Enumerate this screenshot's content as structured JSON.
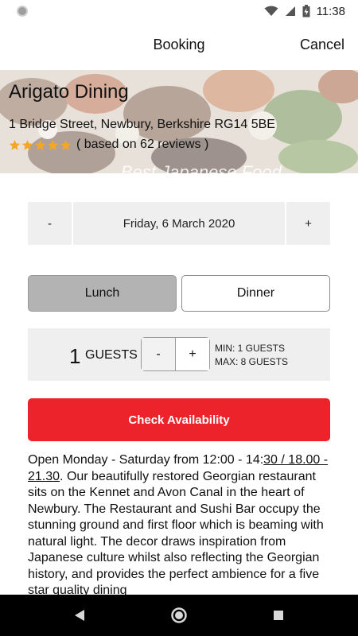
{
  "status_bar": {
    "time": "11:38"
  },
  "header": {
    "title": "Booking",
    "cancel_label": "Cancel"
  },
  "restaurant": {
    "name": "Arigato Dining",
    "address": "1 Bridge Street, Newbury, Berkshire RG14 5BE",
    "stars": 5,
    "star_color": "#f5a623",
    "reviews_text": "( based on 62 reviews )",
    "tagline": "Best Japanese Food"
  },
  "date_picker": {
    "minus_label": "-",
    "date": "Friday, 6 March 2020",
    "plus_label": "+"
  },
  "meal": {
    "lunch_label": "Lunch",
    "dinner_label": "Dinner",
    "selected": "Lunch"
  },
  "guests": {
    "count": "1",
    "label": "GUESTS",
    "minus_label": "-",
    "plus_label": "+",
    "min_text": "MIN: 1 GUESTS",
    "max_text": "MAX: 8 GUESTS"
  },
  "check_button": {
    "label": "Check Availability",
    "color": "#ec232a"
  },
  "description": {
    "intro": "Open Monday - Saturday from 12:00 - 14:",
    "hours_link": "30 / 18.00 - 21.30",
    "body": ". Our beautifully restored Georgian restaurant sits on the Kennet and Avon Canal in the heart of Newbury. The Restaurant and Sushi Bar occupy the stunning ground and first floor which is beaming with natural light. The decor draws inspiration from Japanese culture whilst also reflecting the Georgian history, and provides the perfect ambience for a five star quality dining"
  },
  "icons": {
    "status": [
      "notification-dot-icon",
      "wifi-icon",
      "signal-icon",
      "battery-icon"
    ],
    "nav": [
      "back-icon",
      "home-icon",
      "recents-icon"
    ]
  }
}
